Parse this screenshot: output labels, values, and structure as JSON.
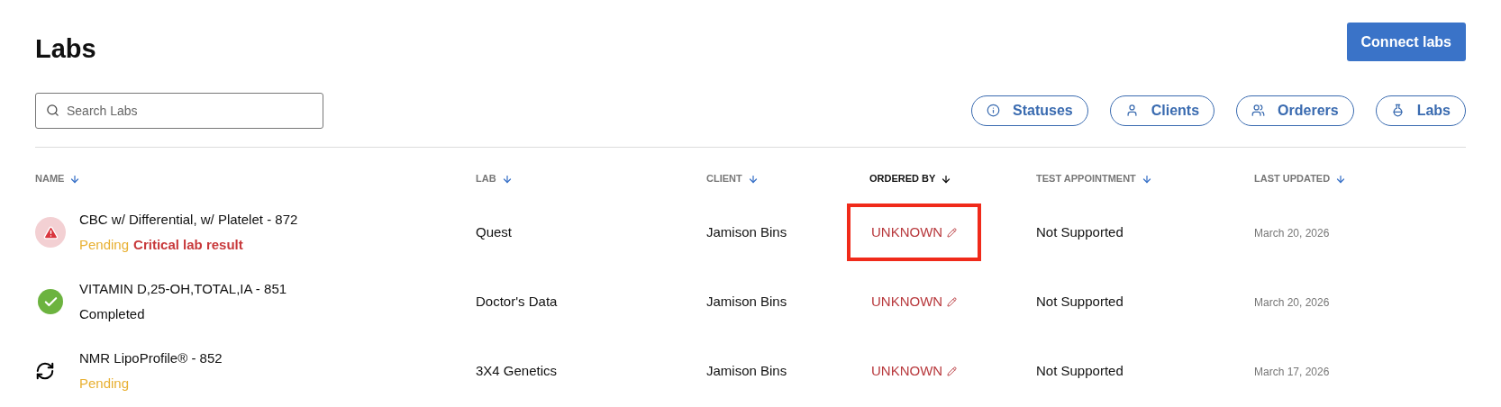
{
  "title": "Labs",
  "connect_button": "Connect labs",
  "search": {
    "placeholder": "Search Labs"
  },
  "filters": [
    {
      "label": "Statuses",
      "kind": "info"
    },
    {
      "label": "Clients",
      "kind": "person"
    },
    {
      "label": "Orderers",
      "kind": "people"
    },
    {
      "label": "Labs",
      "kind": "flask"
    }
  ],
  "table": {
    "columns": [
      {
        "label": "NAME",
        "selected": false
      },
      {
        "label": "LAB",
        "selected": false
      },
      {
        "label": "CLIENT",
        "selected": false
      },
      {
        "label": "ORDERED BY",
        "selected": true
      },
      {
        "label": "TEST APPOINTMENT",
        "selected": false
      },
      {
        "label": "LAST UPDATED",
        "selected": false
      }
    ],
    "rows": [
      {
        "kind": "critical",
        "name": "CBC w/ Differential, w/ Platelet - 872",
        "statuses": [
          {
            "label": "Pending",
            "kind": "pending"
          },
          {
            "label": "Critical lab result",
            "kind": "critical"
          }
        ],
        "lab": "Quest",
        "client": "Jamison Bins",
        "ordered_by": "UNKNOWN",
        "ordered_by_highlighted": true,
        "test_appointment": "Not Supported",
        "last_updated": "March 20, 2026"
      },
      {
        "kind": "completed",
        "name": "VITAMIN D,25-OH,TOTAL,IA - 851",
        "statuses": [
          {
            "label": "Completed",
            "kind": "completed"
          }
        ],
        "lab": "Doctor's Data",
        "client": "Jamison Bins",
        "ordered_by": "UNKNOWN",
        "ordered_by_highlighted": false,
        "test_appointment": "Not Supported",
        "last_updated": "March 20, 2026"
      },
      {
        "kind": "syncing",
        "name": "NMR LipoProfile® - 852",
        "statuses": [
          {
            "label": "Pending",
            "kind": "pending"
          }
        ],
        "lab": "3X4 Genetics",
        "client": "Jamison Bins",
        "ordered_by": "UNKNOWN",
        "ordered_by_highlighted": false,
        "test_appointment": "Not Supported",
        "last_updated": "March 17, 2026"
      }
    ]
  }
}
